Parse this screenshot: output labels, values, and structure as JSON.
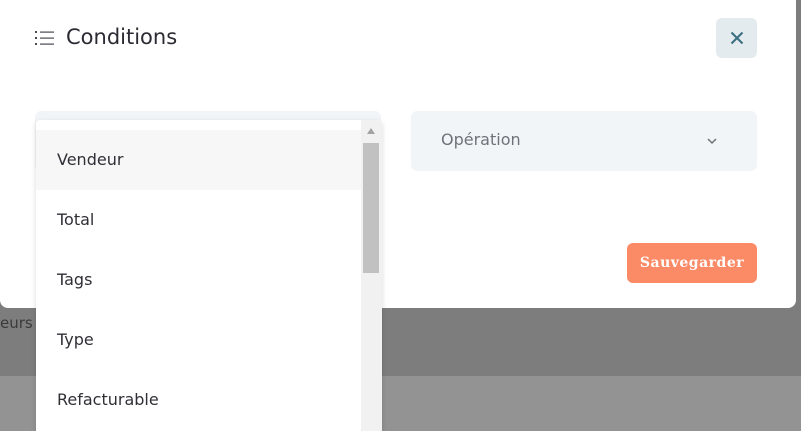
{
  "background": {
    "partial_text": "eurs"
  },
  "modal": {
    "title": "Conditions",
    "title_icon": "list-icon",
    "close_icon": "close-icon",
    "close_color": "#3c6e82",
    "operation": {
      "placeholder": "Opération",
      "icon": "chevron-down-icon"
    },
    "save_label": "Sauvegarder",
    "accent": "#fb8a66"
  },
  "dropdown": {
    "options": [
      {
        "label": "Vendeur"
      },
      {
        "label": "Total"
      },
      {
        "label": "Tags"
      },
      {
        "label": "Type"
      },
      {
        "label": "Refacturable"
      }
    ],
    "hovered_option": "Vendeur",
    "scroll_up_icon": "scroll-up-arrow-icon"
  }
}
